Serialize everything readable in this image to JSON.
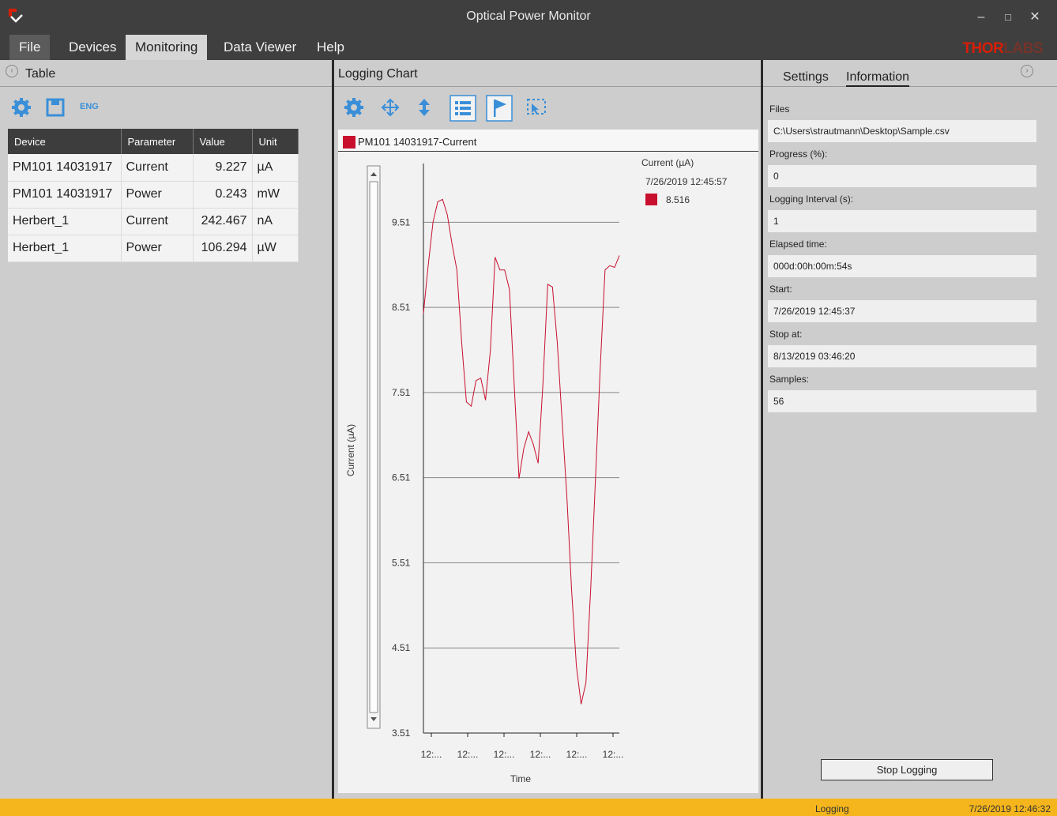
{
  "window": {
    "title": "Optical Power Monitor"
  },
  "menu": {
    "items": [
      "File",
      "Devices",
      "Monitoring",
      "Data Viewer",
      "Help"
    ]
  },
  "brand": {
    "part1": "THOR",
    "part2": "LABS"
  },
  "left_panel": {
    "title": "Table",
    "toolbar": {
      "settings_icon": "gear-icon",
      "save_icon": "save-icon",
      "lang_label": "ENG"
    },
    "columns": [
      "Device",
      "Parameter",
      "Value",
      "Unit"
    ],
    "rows": [
      [
        "PM101 14031917",
        "Current",
        "9.227",
        "µA"
      ],
      [
        "PM101 14031917",
        "Power",
        "0.243",
        "mW"
      ],
      [
        "Herbert_1",
        "Current",
        "242.467",
        "nA"
      ],
      [
        "Herbert_1",
        "Power",
        "106.294",
        "µW"
      ]
    ]
  },
  "mid_panel": {
    "title": "Logging Chart",
    "toolbar_icons": [
      "gear-icon",
      "pan-icon",
      "vertical-zoom-icon",
      "list-icon",
      "flag-icon",
      "zoom-select-icon"
    ],
    "series_legend": "PM101 14031917-Current",
    "cursor": {
      "label": "Current (µA)",
      "time": "7/26/2019 12:45:57",
      "value": "8.516"
    },
    "colors": {
      "series": "#c8102e"
    }
  },
  "chart_data": {
    "type": "line",
    "ylabel": "Current (µA)",
    "xlabel": "Time",
    "y_ticks": [
      "9.51",
      "8.51",
      "7.51",
      "6.51",
      "5.51",
      "4.51",
      "3.51"
    ],
    "x_ticks": [
      "12:...",
      "12:...",
      "12:...",
      "12:...",
      "12:...",
      "12:..."
    ],
    "ylim": [
      3.51,
      10.2
    ],
    "series": [
      {
        "values": [
          8.44,
          9.0,
          9.51,
          9.75,
          9.78,
          9.6,
          9.25,
          8.95,
          8.1,
          7.4,
          7.35,
          7.65,
          7.68,
          7.42,
          8.0,
          9.1,
          8.95,
          8.95,
          8.72,
          7.6,
          6.5,
          6.85,
          7.05,
          6.9,
          6.68,
          7.6,
          8.78,
          8.75,
          8.1,
          7.2,
          6.3,
          5.2,
          4.3,
          3.85,
          4.1,
          5.2,
          6.5,
          7.8,
          8.95,
          9.0,
          8.98,
          9.12
        ]
      }
    ]
  },
  "right_panel": {
    "tabs": [
      "Settings",
      "Information"
    ],
    "fields": [
      {
        "label": "Files",
        "value": "C:\\Users\\strautmann\\Desktop\\Sample.csv"
      },
      {
        "label": "Progress (%):",
        "value": "0"
      },
      {
        "label": "Logging Interval (s):",
        "value": "1"
      },
      {
        "label": "Elapsed time:",
        "value": "000d:00h:00m:54s"
      },
      {
        "label": "Start:",
        "value": "7/26/2019 12:45:37"
      },
      {
        "label": "Stop at:",
        "value": "8/13/2019 03:46:20"
      },
      {
        "label": "Samples:",
        "value": "56"
      }
    ],
    "stop_button": "Stop Logging"
  },
  "status": {
    "text": "Logging",
    "time": "7/26/2019 12:46:32"
  }
}
